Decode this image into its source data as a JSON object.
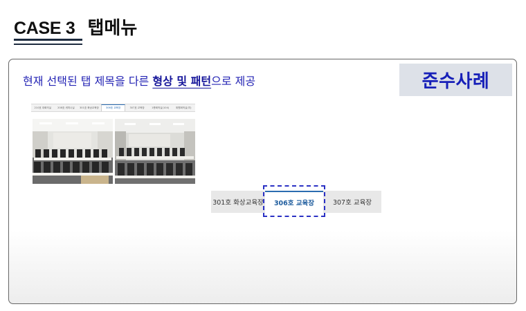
{
  "heading": {
    "case_label": "CASE 3",
    "title": "탭메뉴"
  },
  "description": {
    "prefix": "현재 선택된 탭 제목을 다른 ",
    "emphasis_1": "형상 및 패턴",
    "suffix": "으로 제공"
  },
  "badge": {
    "label": "준수사례"
  },
  "mini_tabs": [
    {
      "label": "210호 대회의실",
      "active": false
    },
    {
      "label": "208호 세미나실",
      "active": false
    },
    {
      "label": "301호 화상교육장",
      "active": false
    },
    {
      "label": "306호 교육장",
      "active": true
    },
    {
      "label": "307호 교육장",
      "active": false
    },
    {
      "label": "1층회의실(104)",
      "active": false
    },
    {
      "label": "위원회의실(지)",
      "active": false
    }
  ],
  "tabs": [
    {
      "label": "301호 화상교육장",
      "selected": false
    },
    {
      "label": "306호 교육장",
      "selected": true
    },
    {
      "label": "307호 교육장",
      "selected": false
    }
  ],
  "colors": {
    "text_blue": "#2323b4",
    "badge_bg": "#dde1e8",
    "badge_text": "#1720b8",
    "focus_outline": "#2a30c4",
    "active_tab_text": "#1f5d9e"
  }
}
